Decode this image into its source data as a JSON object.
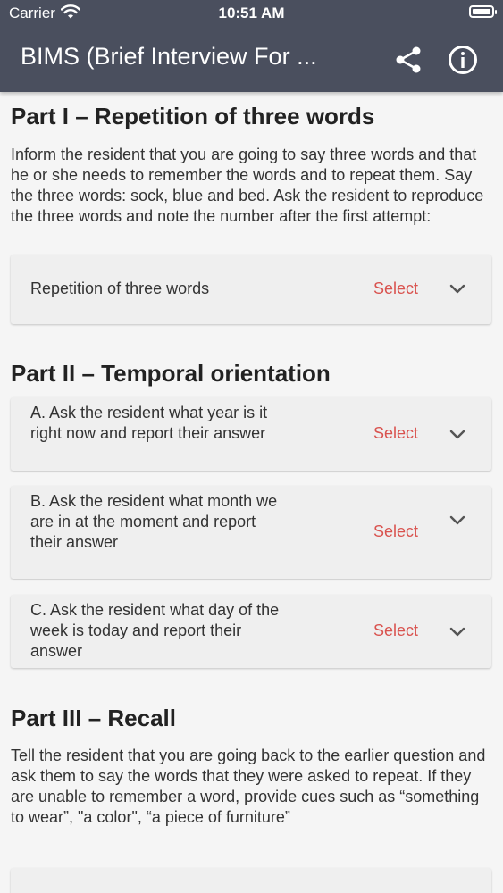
{
  "status_bar": {
    "carrier": "Carrier",
    "time": "10:51 AM"
  },
  "header": {
    "title": "BIMS (Brief Interview For ...",
    "share_icon": "share-icon",
    "info_icon": "info-icon"
  },
  "colors": {
    "header_bg": "#4a4f5e",
    "select_text": "#d9534f",
    "card_bg": "#efefef",
    "page_bg": "#f5f5f5"
  },
  "sections": [
    {
      "title": "Part I – Repetition of three words",
      "description": "Inform the resident that you are going to say three words and that he or she needs to remember the words and to repeat them. Say the three words: sock, blue and bed. Ask the resident to reproduce the three words and note the number after the first attempt:",
      "questions": [
        {
          "label": "Repetition of three words",
          "value": "Select"
        }
      ]
    },
    {
      "title": "Part II – Temporal orientation",
      "questions": [
        {
          "label": "A. Ask the resident what year is it right now and report their answer",
          "value": "Select"
        },
        {
          "label": "B. Ask the resident what month we are in at the moment and report their answer",
          "value": "Select"
        },
        {
          "label": "C. Ask the resident what day of the week is today and report their answer",
          "value": "Select"
        }
      ]
    },
    {
      "title": "Part III – Recall",
      "description": "Tell the resident that you are going back to the earlier question and ask them to say the words that they were asked to repeat. If they are unable to remember a word, provide cues such as “something to wear”, \"a color\", “a piece of furniture”"
    }
  ]
}
